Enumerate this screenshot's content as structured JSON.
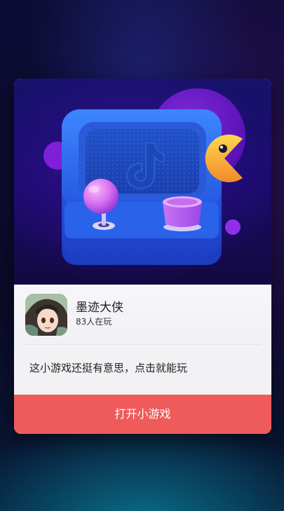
{
  "game": {
    "name": "墨迹大侠",
    "players": "83人在玩",
    "icon": "game-avatar-girl"
  },
  "description": "这小游戏还挺有意思，点击就能玩",
  "action": {
    "open_label": "打开小游戏"
  },
  "hero": {
    "illustration": "arcade-machine-with-tiktok-logo",
    "colors": {
      "machine_blue": "#2f6df0",
      "joystick_pink": "#e07ef0",
      "button_purple": "#b463f0",
      "pacman_yellow": "#f7c23c",
      "orb_purple": "#7f1fd8"
    }
  },
  "colors": {
    "button_bg": "#ef5a5b",
    "card_bg": "#f4f4f7"
  }
}
